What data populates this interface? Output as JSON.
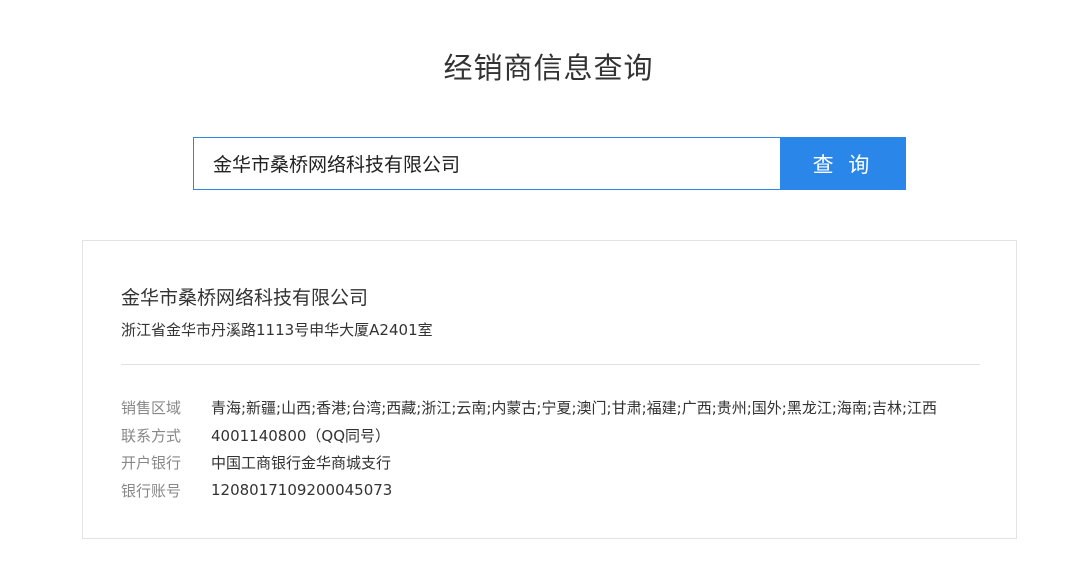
{
  "header": {
    "title": "经销商信息查询"
  },
  "search": {
    "value": "金华市桑桥网络科技有限公司",
    "button_label": "查 询"
  },
  "result": {
    "company_name": "金华市桑桥网络科技有限公司",
    "address": "浙江省金华市丹溪路1113号申华大厦A2401室",
    "rows": [
      {
        "label": "销售区域",
        "value": "青海;新疆;山西;香港;台湾;西藏;浙江;云南;内蒙古;宁夏;澳门;甘肃;福建;广西;贵州;国外;黑龙江;海南;吉林;江西"
      },
      {
        "label": "联系方式",
        "value": "4001140800（QQ同号）"
      },
      {
        "label": "开户银行",
        "value": "中国工商银行金华商城支行"
      },
      {
        "label": "银行账号",
        "value": "1208017109200045073"
      }
    ]
  },
  "colors": {
    "accent": "#2a86e8",
    "label_gray": "#888888",
    "text": "#333333",
    "card_border": "#e3e3e3"
  }
}
